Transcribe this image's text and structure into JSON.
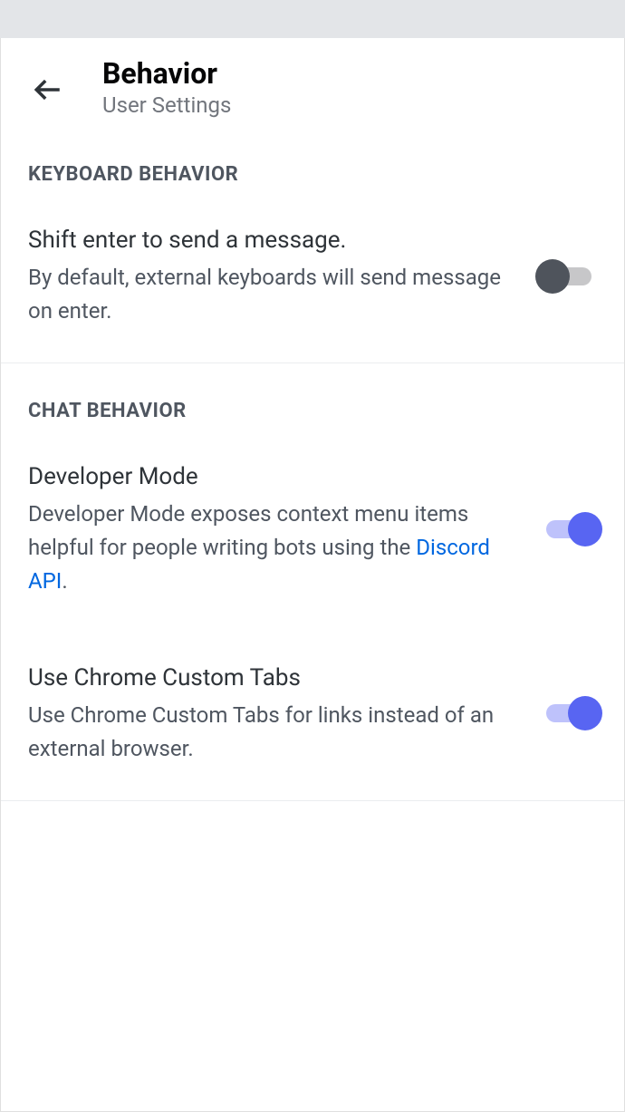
{
  "header": {
    "title": "Behavior",
    "subtitle": "User Settings"
  },
  "sections": {
    "keyboard": {
      "header": "KEYBOARD BEHAVIOR",
      "shift_enter": {
        "title": "Shift enter to send a message.",
        "description": "By default, external keyboards will send message on enter.",
        "enabled": false
      }
    },
    "chat": {
      "header": "CHAT BEHAVIOR",
      "developer_mode": {
        "title": "Developer Mode",
        "description_prefix": "Developer Mode exposes context menu items helpful for people writing bots using the ",
        "link_text": "Discord API",
        "description_suffix": ".",
        "enabled": true
      },
      "chrome_tabs": {
        "title": "Use Chrome Custom Tabs",
        "description": "Use Chrome Custom Tabs for links instead of an external browser.",
        "enabled": true
      }
    }
  }
}
